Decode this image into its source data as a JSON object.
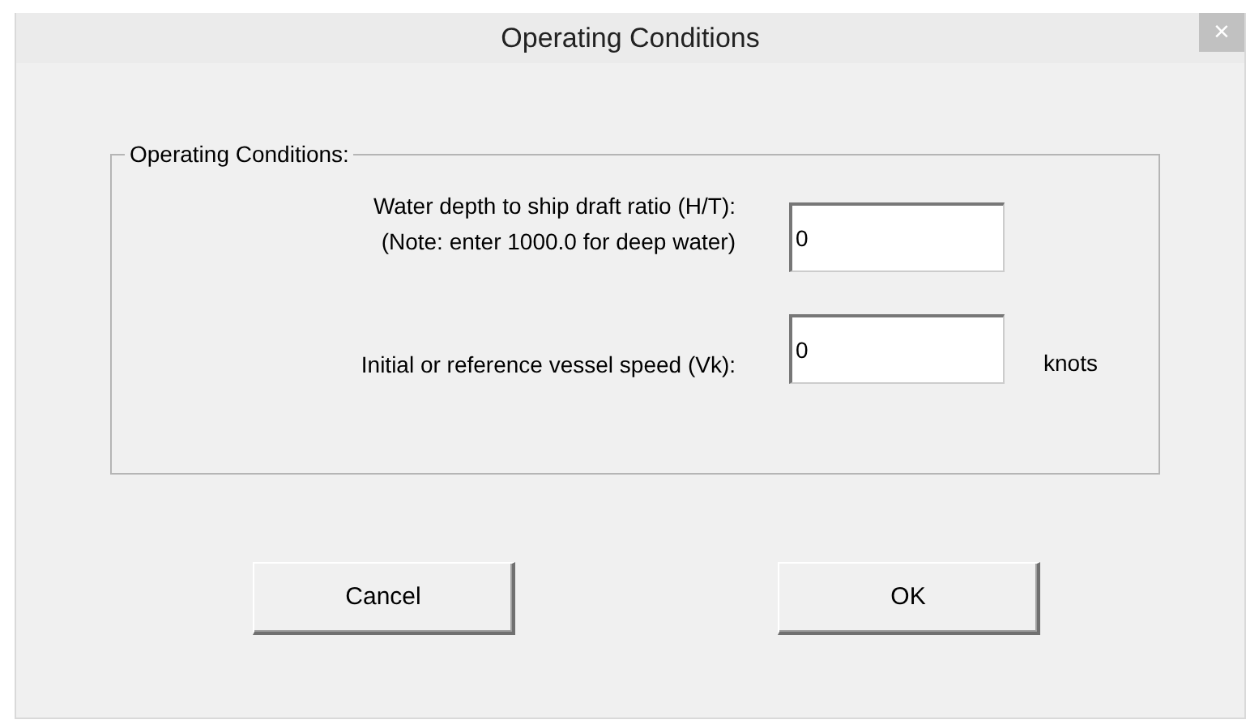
{
  "window": {
    "title": "Operating Conditions",
    "close": "×"
  },
  "group": {
    "legend": "Operating Conditions:",
    "fields": [
      {
        "label": "Water depth to ship draft ratio (H/T):",
        "note": "(Note: enter 1000.0 for deep water)",
        "value": "0"
      },
      {
        "label": "Initial or reference vessel speed (Vk):",
        "value": "0",
        "unit": "knots"
      }
    ]
  },
  "buttons": [
    "Cancel",
    "OK"
  ]
}
